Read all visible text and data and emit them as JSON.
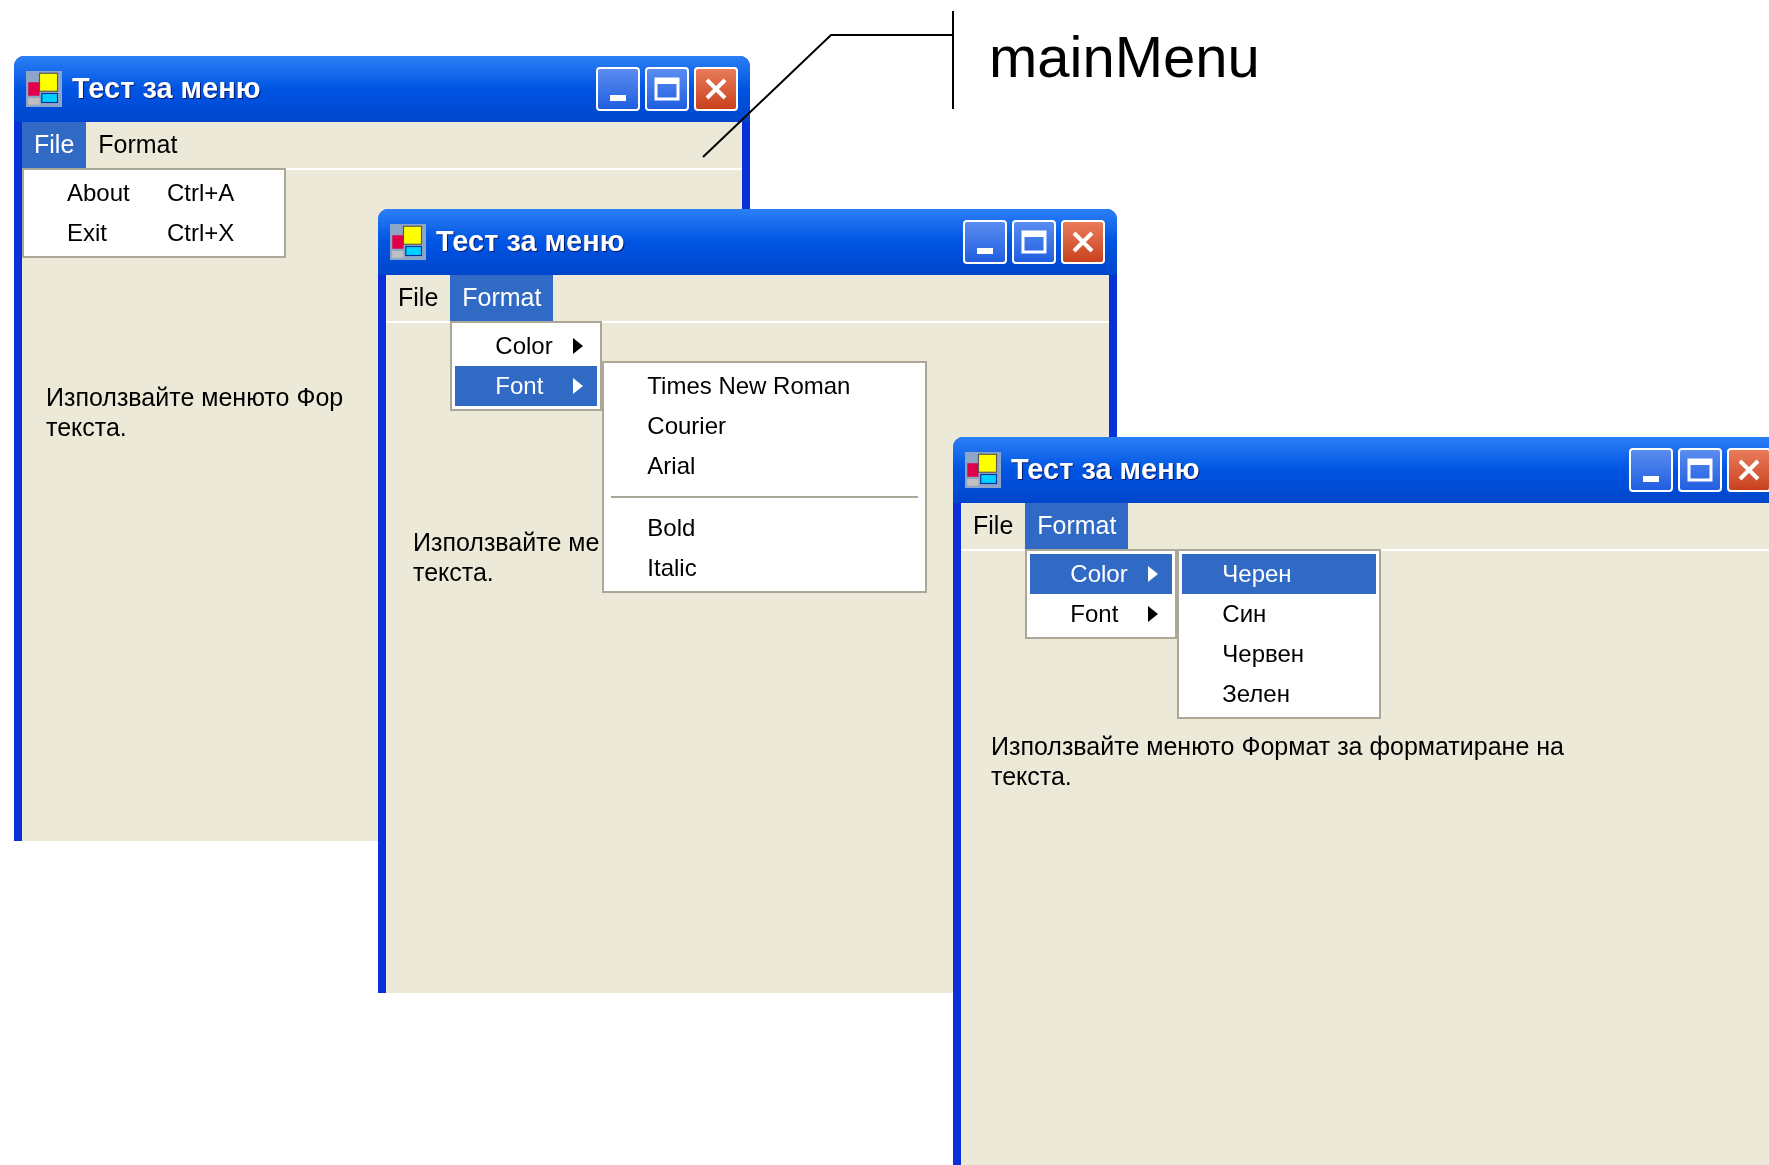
{
  "callout": {
    "label": "mainMenu"
  },
  "windows": [
    {
      "title": "Тест за меню",
      "menu": [
        {
          "label": "File",
          "selected": true,
          "items": [
            {
              "kind": "command",
              "label": "About",
              "shortcut": "Ctrl+A",
              "selected": false
            },
            {
              "kind": "command",
              "label": "Exit",
              "shortcut": "Ctrl+X",
              "selected": false
            }
          ]
        },
        {
          "label": "Format",
          "selected": false
        }
      ],
      "label_lines": [
        "Използвайте менюто Фор",
        "текста."
      ]
    },
    {
      "title": "Тест за меню",
      "menu": [
        {
          "label": "File",
          "selected": false
        },
        {
          "label": "Format",
          "selected": true,
          "items": [
            {
              "kind": "submenu",
              "label": "Color",
              "selected": false
            },
            {
              "kind": "submenu",
              "label": "Font",
              "selected": true,
              "items": [
                {
                  "kind": "command",
                  "label": "Times New Roman",
                  "selected": false
                },
                {
                  "kind": "command",
                  "label": "Courier",
                  "selected": false
                },
                {
                  "kind": "command",
                  "label": "Arial",
                  "selected": false
                },
                {
                  "kind": "separator"
                },
                {
                  "kind": "command",
                  "label": "Bold",
                  "selected": false
                },
                {
                  "kind": "command",
                  "label": "Italic",
                  "selected": false
                }
              ]
            }
          ]
        }
      ],
      "label_lines": [
        "Използвайте ме",
        "текста."
      ]
    },
    {
      "title": "Тест за меню",
      "menu": [
        {
          "label": "File",
          "selected": false
        },
        {
          "label": "Format",
          "selected": true,
          "items": [
            {
              "kind": "submenu",
              "label": "Color",
              "selected": true,
              "items": [
                {
                  "kind": "command",
                  "label": "Черен",
                  "selected": true
                },
                {
                  "kind": "command",
                  "label": "Син",
                  "selected": false
                },
                {
                  "kind": "command",
                  "label": "Червен",
                  "selected": false
                },
                {
                  "kind": "command",
                  "label": "Зелен",
                  "selected": false
                }
              ]
            },
            {
              "kind": "submenu",
              "label": "Font",
              "selected": false
            }
          ]
        }
      ],
      "label_lines": [
        "Използвайте менюто Формат за форматиране на",
        "текста."
      ]
    }
  ]
}
